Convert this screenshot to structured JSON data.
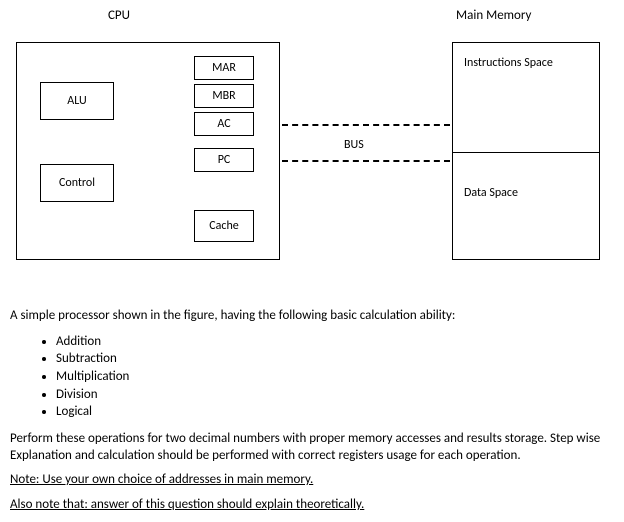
{
  "titles": {
    "cpu": "CPU",
    "memory": "Main Memory"
  },
  "cpu_blocks": {
    "alu": "ALU",
    "control": "Control",
    "mar": "MAR",
    "mbr": "MBR",
    "ac": "AC",
    "pc": "PC",
    "cache": "Cache"
  },
  "memory": {
    "instructions": "Instructions Space",
    "data": "Data Space"
  },
  "bus": "BUS",
  "intro": "A simple processor shown in the figure, having the following basic calculation ability:",
  "ops": [
    "Addition",
    "Subtraction",
    "Multiplication",
    "Division",
    "Logical"
  ],
  "task": "Perform these operations for two decimal numbers with proper memory accesses and results storage. Step wise Explanation and calculation should be performed with correct registers usage for each operation.",
  "note1": "Note: Use your own choice of addresses in main memory.",
  "note2": "Also note that: answer of this question should explain theoretically."
}
